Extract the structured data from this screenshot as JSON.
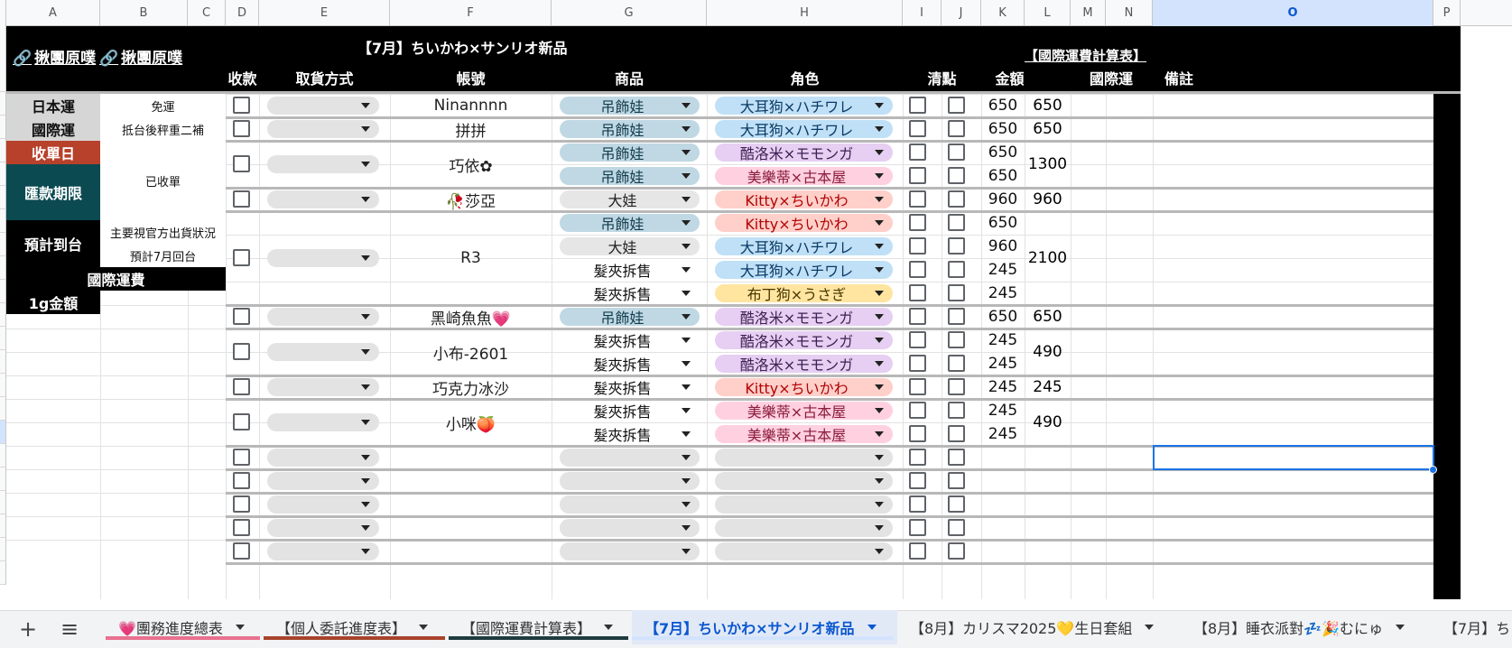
{
  "columns": [
    "A",
    "B",
    "C",
    "D",
    "E",
    "F",
    "G",
    "H",
    "I",
    "J",
    "K",
    "L",
    "M",
    "N",
    "O",
    "P"
  ],
  "selected_column": "O",
  "header": {
    "link_a": "揪團原噗",
    "link_b": "揪團原噗",
    "title": "【7月】ちいかわ×サンリオ新品",
    "intl_calc_link": "【國際運費計算表】",
    "headers": {
      "paid": "收款",
      "pickup": "取貨方式",
      "account": "帳號",
      "product": "商品",
      "character": "角色",
      "check": "清點",
      "amount": "金額",
      "intl_ship": "國際運",
      "notes": "備註"
    }
  },
  "sidebar": {
    "jp_ship_label": "日本運",
    "jp_ship_value": "免運",
    "intl_ship_label": "國際運",
    "intl_ship_value": "抵台後秤重二補",
    "close_label": "收單日",
    "close_value": "已收單",
    "pay_label": "匯款期限",
    "arrival_label": "預計到台",
    "arrival_value1": "主要視官方出貨狀況",
    "arrival_value2": "預計7月回台",
    "intl_fee_label": "國際運費",
    "per_gram_label": "1g金額"
  },
  "orders": [
    {
      "account": "Ninannnn",
      "total": "650",
      "items": [
        {
          "product": "吊飾娃",
          "character": "大耳狗×ハチワレ",
          "price": "650"
        }
      ]
    },
    {
      "account": "拼拼",
      "total": "650",
      "items": [
        {
          "product": "吊飾娃",
          "character": "大耳狗×ハチワレ",
          "price": "650"
        }
      ]
    },
    {
      "account": "巧依✿",
      "total": "1300",
      "items": [
        {
          "product": "吊飾娃",
          "character": "酷洛米×モモンガ",
          "price": "650"
        },
        {
          "product": "吊飾娃",
          "character": "美樂蒂×古本屋",
          "price": "650"
        }
      ]
    },
    {
      "account": "🥀莎亞",
      "total": "960",
      "items": [
        {
          "product": "大娃",
          "character": "Kitty×ちいかわ",
          "price": "960"
        }
      ]
    },
    {
      "account": "R3",
      "total": "2100",
      "items": [
        {
          "product": "吊飾娃",
          "character": "Kitty×ちいかわ",
          "price": "650"
        },
        {
          "product": "大娃",
          "character": "大耳狗×ハチワレ",
          "price": "960"
        },
        {
          "product": "髮夾拆售",
          "character": "大耳狗×ハチワレ",
          "price": "245"
        },
        {
          "product": "髮夾拆售",
          "character": "布丁狗×うさぎ",
          "price": "245"
        }
      ]
    },
    {
      "account": "黑崎魚魚💗",
      "total": "650",
      "items": [
        {
          "product": "吊飾娃",
          "character": "酷洛米×モモンガ",
          "price": "650"
        }
      ]
    },
    {
      "account": "小布-2601",
      "total": "490",
      "items": [
        {
          "product": "髮夾拆售",
          "character": "酷洛米×モモンガ",
          "price": "245"
        },
        {
          "product": "髮夾拆售",
          "character": "酷洛米×モモンガ",
          "price": "245"
        }
      ]
    },
    {
      "account": "巧克力冰沙",
      "total": "245",
      "items": [
        {
          "product": "髮夾拆售",
          "character": "Kitty×ちいかわ",
          "price": "245"
        }
      ]
    },
    {
      "account": "小咪🍑",
      "total": "490",
      "items": [
        {
          "product": "髮夾拆售",
          "character": "美樂蒂×古本屋",
          "price": "245"
        },
        {
          "product": "髮夾拆售",
          "character": "美樂蒂×古本屋",
          "price": "245"
        }
      ]
    }
  ],
  "chip_colors": {
    "吊飾娃": {
      "bg": "#bfd8e3",
      "fg": "#123c4e"
    },
    "大娃": {
      "bg": "#e6e6e6",
      "fg": "#222222"
    },
    "髮夾拆售": {
      "bg": "#ffffff",
      "fg": "#111111"
    },
    "大耳狗×ハチワレ": {
      "bg": "#bfe0f6",
      "fg": "#0a3a66"
    },
    "酷洛米×モモンガ": {
      "bg": "#e6cff2",
      "fg": "#3d1f52"
    },
    "美樂蒂×古本屋": {
      "bg": "#ffd0e0",
      "fg": "#8a1c3c"
    },
    "Kitty×ちいかわ": {
      "bg": "#ffcfc9",
      "fg": "#b10202"
    },
    "布丁狗×うさぎ": {
      "bg": "#ffe5a0",
      "fg": "#4a3500"
    }
  },
  "colors": {
    "side_red": "#b7412b",
    "side_teal": "#0c4a52",
    "side_gray": "#d6d6d6",
    "selection": "#1a73e8",
    "link_green": "#34a853"
  },
  "sheet_tabs": [
    {
      "label": "💗團務進度總表",
      "color": "#e8708e",
      "active": false
    },
    {
      "label": "【個人委託進度表】",
      "color": "#a8432c",
      "active": false
    },
    {
      "label": "【國際運費計算表】",
      "color": "#1e3c40",
      "active": false
    },
    {
      "label": "【7月】ちいかわ×サンリオ新品",
      "color": "#d3e3fd",
      "active": true
    },
    {
      "label": "【8月】カリスマ2025💛生日套組",
      "color": "",
      "active": false
    },
    {
      "label": "【8月】睡衣派對💤🎉むにゅ",
      "color": "",
      "active": false
    },
    {
      "label": "【7月】ち",
      "color": "",
      "active": false
    }
  ],
  "bottom_controls": {
    "add_label": "+",
    "menu_label": "≡"
  }
}
